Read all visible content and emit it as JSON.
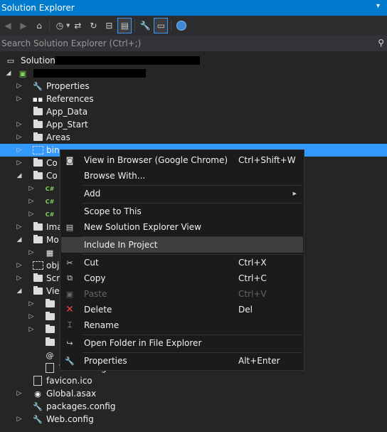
{
  "window": {
    "title": "Solution Explorer",
    "pin_icon": "pin-icon"
  },
  "toolbar": {
    "buttons": [
      "back-icon",
      "forward-icon",
      "home-icon",
      "history-icon",
      "sync-icon",
      "refresh-icon",
      "collapse-icon",
      "show-all-files-icon",
      "properties-icon",
      "preview-icon",
      "browser-link-icon"
    ]
  },
  "search": {
    "placeholder": "Search Solution Explorer (Ctrl+;)"
  },
  "tree": {
    "solution_label": "Solution",
    "items": [
      {
        "label": "Properties"
      },
      {
        "label": "References"
      },
      {
        "label": "App_Data"
      },
      {
        "label": "App_Start"
      },
      {
        "label": "Areas"
      },
      {
        "label": "bin"
      },
      {
        "label": "Co"
      },
      {
        "label": "Co"
      },
      {
        "label": "Ima"
      },
      {
        "label": "Mo"
      },
      {
        "label": "obj"
      },
      {
        "label": "Scr"
      },
      {
        "label": "Vie"
      },
      {
        "label": "Web.config"
      },
      {
        "label": "favicon.ico"
      },
      {
        "label": "Global.asax"
      },
      {
        "label": "packages.config"
      },
      {
        "label": "Web.config"
      }
    ]
  },
  "context_menu": {
    "items": [
      {
        "label": "View in Browser (Google Chrome)",
        "shortcut": "Ctrl+Shift+W"
      },
      {
        "label": "Browse With...",
        "shortcut": ""
      },
      {
        "label": "Add",
        "shortcut": ""
      },
      {
        "label": "Scope to This",
        "shortcut": ""
      },
      {
        "label": "New Solution Explorer View",
        "shortcut": ""
      },
      {
        "label": "Include In Project",
        "shortcut": ""
      },
      {
        "label": "Cut",
        "shortcut": "Ctrl+X"
      },
      {
        "label": "Copy",
        "shortcut": "Ctrl+C"
      },
      {
        "label": "Paste",
        "shortcut": "Ctrl+V"
      },
      {
        "label": "Delete",
        "shortcut": "Del"
      },
      {
        "label": "Rename",
        "shortcut": ""
      },
      {
        "label": "Open Folder in File Explorer",
        "shortcut": ""
      },
      {
        "label": "Properties",
        "shortcut": "Alt+Enter"
      }
    ]
  },
  "colors": {
    "accent": "#007acc",
    "selection": "#3399ff",
    "background": "#252526",
    "menu": "#1b1b1c"
  }
}
